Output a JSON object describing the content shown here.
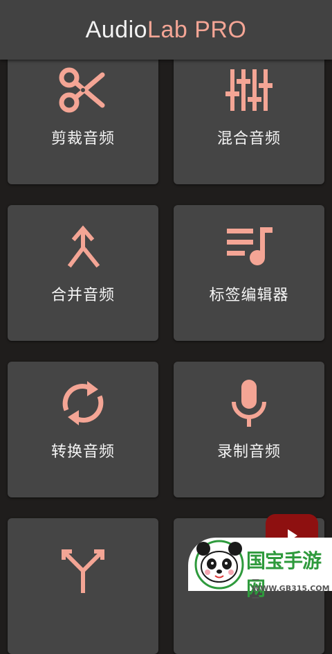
{
  "app": {
    "title_part1": "Audio",
    "title_part2": "Lab PRO",
    "accent_color": "#f4a595",
    "title_color": "#f2f2f2"
  },
  "tiles": [
    {
      "label": "剪裁音频",
      "icon": "scissors-icon"
    },
    {
      "label": "混合音频",
      "icon": "mixer-sliders-icon"
    },
    {
      "label": "合并音频",
      "icon": "merge-arrow-icon"
    },
    {
      "label": "标签编辑器",
      "icon": "playlist-music-icon"
    },
    {
      "label": "转换音频",
      "icon": "sync-arrows-icon"
    },
    {
      "label": "录制音频",
      "icon": "microphone-icon"
    },
    {
      "label": "",
      "icon": "split-arrow-icon"
    },
    {
      "label": "",
      "icon": ""
    }
  ],
  "fab": {
    "icon": "play-icon",
    "color": "#8e1010"
  },
  "watermark": {
    "name": "国宝手游网",
    "url": "— WWW.GB315.COM —",
    "logo": "panda-logo"
  }
}
